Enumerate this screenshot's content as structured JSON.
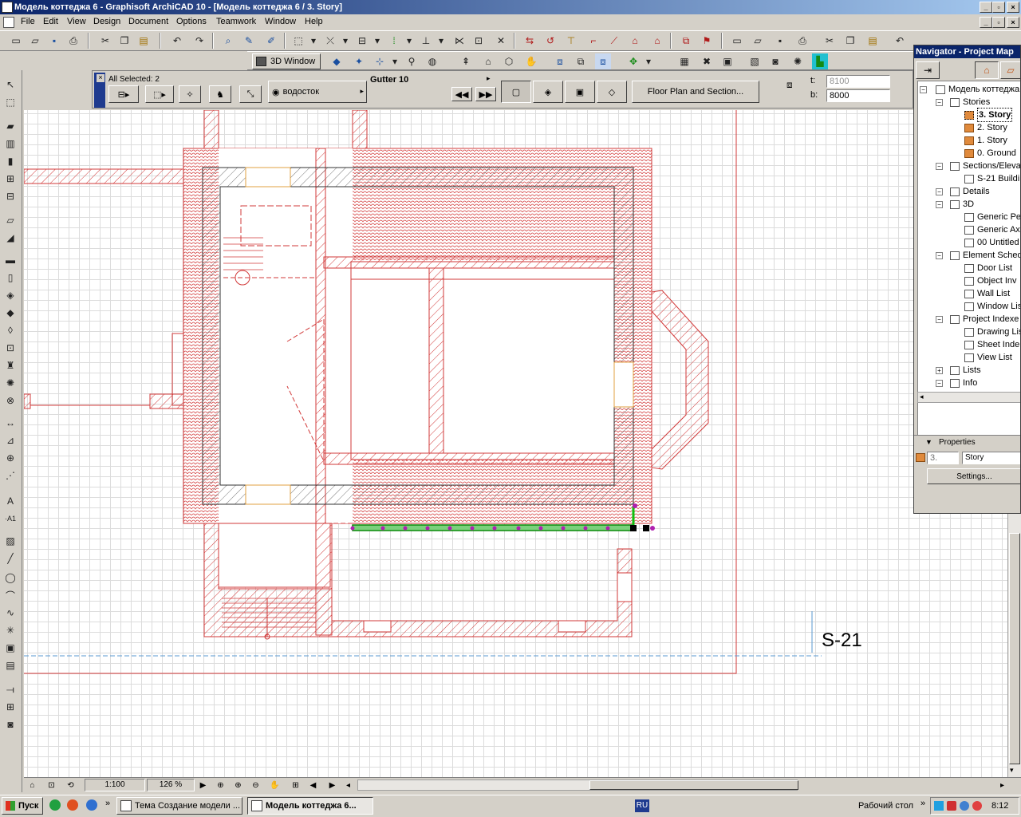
{
  "window": {
    "title": "Модель коттеджа 6 - Graphisoft ArchiCAD 10 - [Модель коттеджа 6 / 3. Story]"
  },
  "menu": [
    "File",
    "Edit",
    "View",
    "Design",
    "Document",
    "Options",
    "Teamwork",
    "Window",
    "Help"
  ],
  "toolbar2": {
    "window3d_label": "3D Window"
  },
  "infobox": {
    "selection": "All Selected: 2",
    "layer_label": "водосток",
    "element_name": "Gutter 10",
    "settings_button": "Floor Plan and Section...",
    "t_label": "t:",
    "t_value": "8100",
    "b_label": "b:",
    "b_value": "8000"
  },
  "drawing": {
    "section_marker": "S-21"
  },
  "statusbar": {
    "scale": "1:100",
    "zoom": "126 %"
  },
  "navigator": {
    "title": "Navigator - Project Map",
    "tree": [
      {
        "label": "Модель коттеджа",
        "level": 0,
        "icon": "house-icon"
      },
      {
        "label": "Stories",
        "level": 1,
        "icon": "folder-icon"
      },
      {
        "label": "3. Story",
        "level": 2,
        "icon": "story-icon",
        "selected": true
      },
      {
        "label": "2. Story",
        "level": 2,
        "icon": "story-icon"
      },
      {
        "label": "1. Story",
        "level": 2,
        "icon": "story-icon"
      },
      {
        "label": "0. Ground",
        "level": 2,
        "icon": "story-icon"
      },
      {
        "label": "Sections/Eleva",
        "level": 1,
        "icon": "section-icon"
      },
      {
        "label": "S-21 Buildin",
        "level": 2,
        "icon": "section-icon"
      },
      {
        "label": "Details",
        "level": 1,
        "icon": "details-icon"
      },
      {
        "label": "3D",
        "level": 1,
        "icon": "3d-icon"
      },
      {
        "label": "Generic Pe",
        "level": 2,
        "icon": "camera-icon"
      },
      {
        "label": "Generic Ax",
        "level": 2,
        "icon": "axon-icon"
      },
      {
        "label": "00 Untitled",
        "level": 2,
        "icon": "camera-icon"
      },
      {
        "label": "Element Sched",
        "level": 1,
        "icon": "schedule-icon"
      },
      {
        "label": "Door List",
        "level": 2,
        "icon": "schedule-icon"
      },
      {
        "label": "Object Inv",
        "level": 2,
        "icon": "schedule-icon"
      },
      {
        "label": "Wall List",
        "level": 2,
        "icon": "schedule-icon"
      },
      {
        "label": "Window Lis",
        "level": 2,
        "icon": "schedule-icon"
      },
      {
        "label": "Project Indexe",
        "level": 1,
        "icon": "index-icon"
      },
      {
        "label": "Drawing Lis",
        "level": 2,
        "icon": "index-icon"
      },
      {
        "label": "Sheet Inde",
        "level": 2,
        "icon": "index-icon"
      },
      {
        "label": "View List",
        "level": 2,
        "icon": "index-icon"
      },
      {
        "label": "Lists",
        "level": 1,
        "icon": "list-icon"
      },
      {
        "label": "Info",
        "level": 1,
        "icon": "info-icon"
      }
    ],
    "properties_label": "Properties",
    "prop_id": "3.",
    "prop_name": "Story",
    "settings_button": "Settings..."
  },
  "taskbar": {
    "start": "Пуск",
    "tasks": [
      "Тема Создание модели ...",
      "Модель коттеджа 6..."
    ],
    "desktop": "Рабочий стол",
    "lang": "RU",
    "clock": "8:12"
  }
}
